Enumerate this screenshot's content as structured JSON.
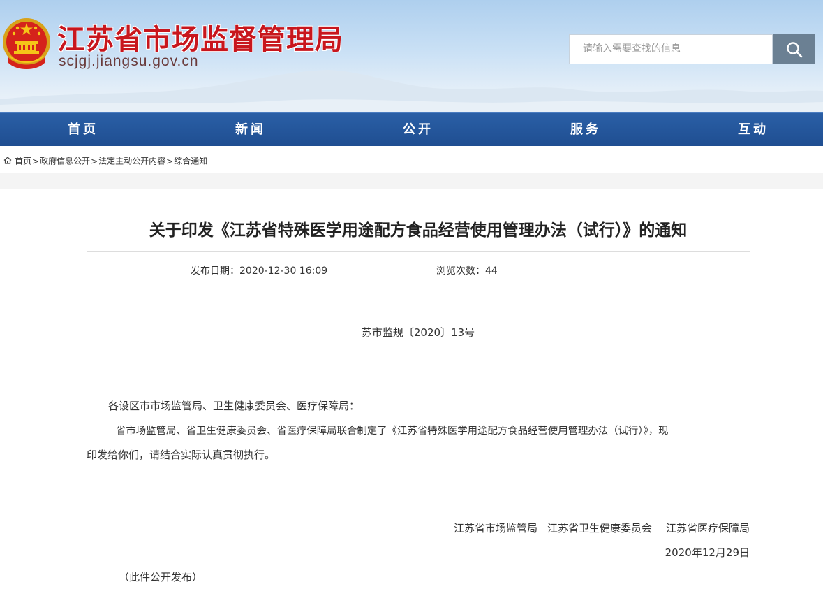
{
  "header": {
    "site_title": "江苏省市场监督管理局",
    "site_domain": "scjgj.jiangsu.gov.cn",
    "search_placeholder": "请输入需要查找的信息"
  },
  "nav": [
    "首页",
    "新闻",
    "公开",
    "服务",
    "互动"
  ],
  "breadcrumb": [
    "首页",
    "政府信息公开",
    "法定主动公开内容",
    "综合通知"
  ],
  "breadcrumb_sep": ">",
  "article": {
    "title": "关于印发《江苏省特殊医学用途配方食品经营使用管理办法（试行）》的通知",
    "publish_label": "发布日期：",
    "publish_date": "2020-12-30 16:09",
    "views_label": "浏览次数：",
    "views": "44",
    "doc_number": "苏市监规〔2020〕13号",
    "salutation": "各设区市市场监管局、卫生健康委员会、医疗保障局：",
    "paragraph_line1": "省市场监管局、省卫生健康委员会、省医疗保障局联合制定了《江苏省特殊医学用途配方食品经营使用管理办法（试行）》，现",
    "paragraph_line2": "印发给你们，请结合实际认真贯彻执行。",
    "signers": [
      "江苏省市场监管局",
      "江苏省卫生健康委员会",
      "江苏省医疗保障局"
    ],
    "sign_date": "2020年12月29日",
    "footnote": "（此件公开发布）"
  },
  "colors": {
    "title_red": "#c8161d",
    "nav_blue": "#1f4e91",
    "search_button": "#6b8093"
  },
  "icons": [
    "national-emblem",
    "search-icon",
    "home-icon"
  ]
}
